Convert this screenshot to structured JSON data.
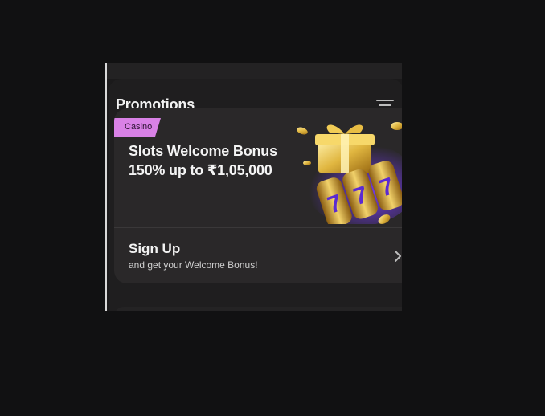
{
  "promotions": {
    "title": "Promotions",
    "filter_icon": "filter-icon",
    "card": {
      "category_badge": "Casino",
      "offer_line_1": "Slots Welcome Bonus",
      "offer_line_2": "150% up to ₹1,05,000",
      "signup_title": "Sign Up",
      "signup_subtitle": "and get your Welcome Bonus!",
      "chevron_icon": "chevron-right-icon",
      "art_icon": "slot-machine-gift-icon"
    }
  },
  "colors": {
    "background": "#111112",
    "panel": "#1f1e1f",
    "card": "#2a2829",
    "badge": "#d981e6",
    "gold": "#e0b640",
    "purple": "#5b2bd1"
  }
}
